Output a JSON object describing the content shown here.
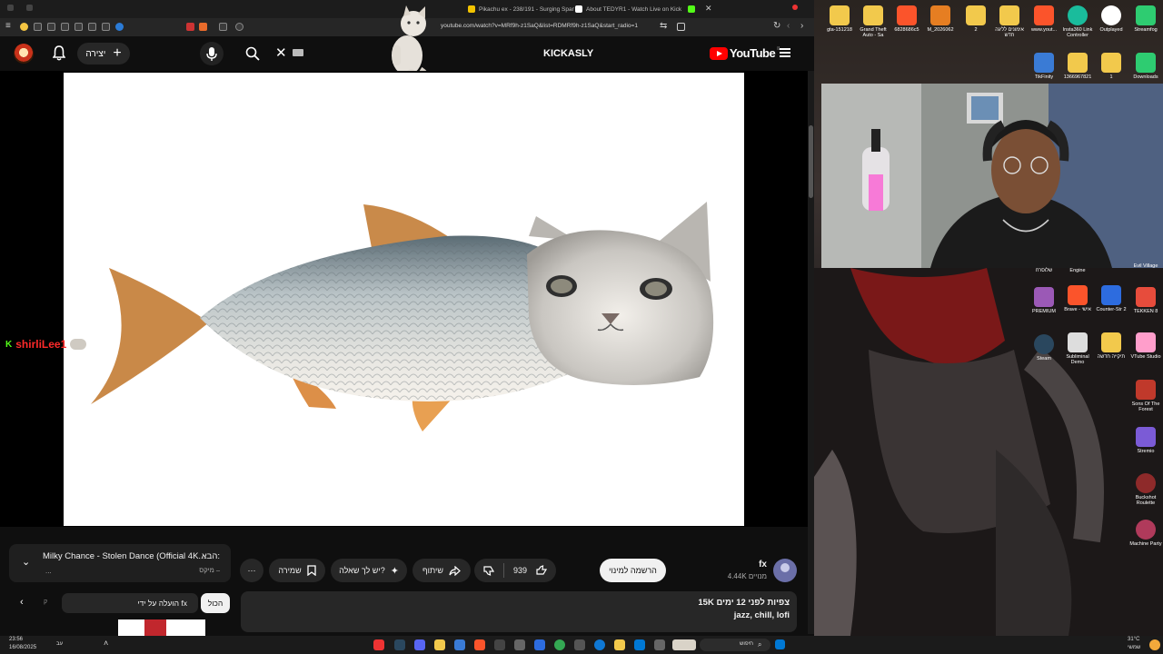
{
  "browser": {
    "tabs": [
      {
        "label": "Pikachu ex - 238/191 - Surging Spar",
        "fav": "#f2c300"
      },
      {
        "label": "About TEDYR1 - Watch Live on Kick",
        "fav": "#ffffff"
      },
      {
        "label": "",
        "fav": "#53fc18"
      }
    ],
    "url": "youtube.com/watch?v=MRf9h-z1SaQ&list=RDMRf9h-z1SaQ&start_radio=1"
  },
  "youtube": {
    "brand": "YouTube",
    "brand_suffix": "IL",
    "search_query": "KICKASLY",
    "create_label": "יצירה",
    "create_plus": "+",
    "clear_glyph": "✕"
  },
  "overlay": {
    "chat_badge": "K",
    "chat_username": "shirliLee1"
  },
  "up_next": {
    "label": "הבא:",
    "title": "Milky Chance - Stolen Dance (Official 4K...",
    "channel": "מיקס –",
    "more": "..."
  },
  "actions": {
    "save": "שמירה",
    "ask": "יש לך שאלה?",
    "share": "שיתוף",
    "likes": "939",
    "subscribe": "הרשמה למינוי",
    "more": "⋯"
  },
  "channel": {
    "name": "fx",
    "subs": "4.44K מנויים"
  },
  "description": {
    "stats": "15K צפיות  לפני 12 ימים",
    "tags": "jazz, chill, lofi"
  },
  "chips": {
    "all": "הכול",
    "uploaded_by": "הועלה על ידי fx",
    "nav": "‹"
  },
  "desktop_icons": [
    {
      "label": "gta-151218",
      "color": "#f2c94c"
    },
    {
      "label": "Grand Theft Auto - Sa",
      "color": "#f2c94c"
    },
    {
      "label": "6828686c5",
      "color": "#fb542b"
    },
    {
      "label": "M_2026062",
      "color": "#e67e22"
    },
    {
      "label": "2",
      "color": "#f2c94c"
    },
    {
      "label": "אימונים לליגה חדש",
      "color": "#f2c94c"
    },
    {
      "label": "www.yout...",
      "color": "#fb542b"
    },
    {
      "label": "Insta360 Link Controller",
      "color": "#1abc9c"
    },
    {
      "label": "Outplayed",
      "color": "#ffffff"
    },
    {
      "label": "Streamfog",
      "color": "#2ecc71"
    },
    {
      "label": "TikFinity",
      "color": "#3a7bd5"
    },
    {
      "label": "1366967821",
      "color": "#f2c94c"
    },
    {
      "label": "1",
      "color": "#f2c94c"
    },
    {
      "label": "Downloads",
      "color": "#2ecc71"
    },
    {
      "label": "שלוסרח",
      "color": "#c0392b"
    },
    {
      "label": "Engine",
      "color": "#444444"
    },
    {
      "label": "Evil Village",
      "color": "#444444"
    },
    {
      "label": "PREMIUM",
      "color": "#9b59b6"
    },
    {
      "label": "Brave - אישי",
      "color": "#fb542b"
    },
    {
      "label": "Counter-Str 2",
      "color": "#2d6cdf"
    },
    {
      "label": "TEKKEN 8",
      "color": "#e74c3c"
    },
    {
      "label": "Steam",
      "color": "#2a475e"
    },
    {
      "label": "Subliminal Demo",
      "color": "#dddddd"
    },
    {
      "label": "תיקייה חדשה",
      "color": "#f2c94c"
    },
    {
      "label": "VTube Studio",
      "color": "#ff9ecb"
    },
    {
      "label": "Sons Of The Forest",
      "color": "#c0392b"
    },
    {
      "label": "Stremio",
      "color": "#7b5bd6"
    },
    {
      "label": "Buckshot Roulette",
      "color": "#8e2a2a"
    },
    {
      "label": "Machine Party",
      "color": "#b03a5b"
    }
  ],
  "taskbar": {
    "time": "23:56",
    "date": "16/08/2025",
    "search": "חיפוש",
    "weather": "31°C",
    "weather_sub": "שמשי",
    "lang": "עב"
  }
}
